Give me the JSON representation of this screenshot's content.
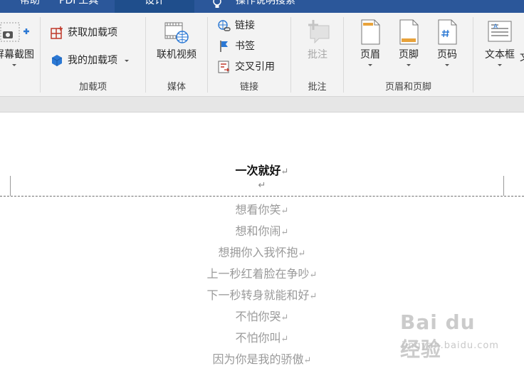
{
  "tabs": [
    {
      "label": "帮助"
    },
    {
      "label": "PDF工具"
    },
    {
      "label": "设计"
    },
    {
      "label": "操作说明搜索"
    }
  ],
  "ribbon": {
    "screenshot": {
      "label": "屏幕截图"
    },
    "addins": {
      "get": "获取加载项",
      "mine": "我的加载项",
      "group": "加载项"
    },
    "media": {
      "online_video": "联机视频",
      "group": "媒体"
    },
    "links": {
      "link": "链接",
      "bookmark": "书签",
      "crossref": "交叉引用",
      "group": "链接"
    },
    "comments": {
      "comment": "批注",
      "group": "批注"
    },
    "header_footer": {
      "header": "页眉",
      "footer": "页脚",
      "page_number": "页码",
      "group": "页眉和页脚"
    },
    "text": {
      "textbox": "文本框",
      "extra": "文"
    }
  },
  "document": {
    "header_title": "一次就好",
    "paragraph_mark": "↵",
    "lines": [
      "想看你笑",
      "想和你闹",
      "想拥你入我怀抱",
      "上一秒红着脸在争吵",
      "下一秒转身就能和好",
      "不怕你哭",
      "不怕你叫",
      "因为你是我的骄傲"
    ]
  },
  "watermark": {
    "logo": "Bai du 经验",
    "url": "jingyan.baidu.com"
  },
  "colors": {
    "tab_bar": "#2b579a",
    "ribbon": "#f3f3f3",
    "doc_text": "#9a9a9a"
  }
}
